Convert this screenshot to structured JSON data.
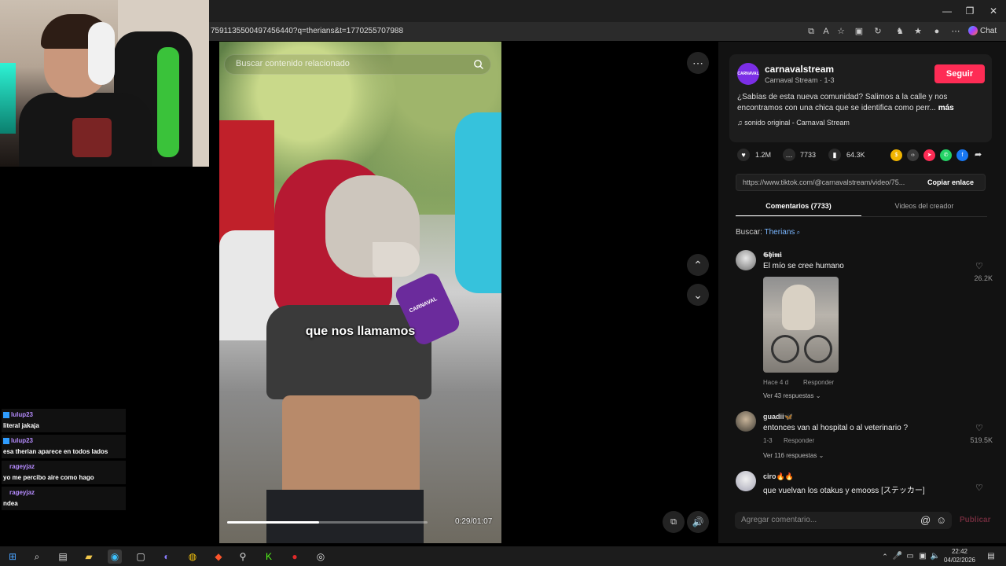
{
  "browser": {
    "url": "7591135500497456440?q=therians&t=1770255707988",
    "chat_label": "Chat",
    "window_controls": {
      "minimize": "—",
      "maximize": "❐",
      "close": "✕"
    }
  },
  "stream_chat": {
    "messages": [
      {
        "user": "lulup23",
        "text": "literal jakaja"
      },
      {
        "user": "lulup23",
        "text": "esa therian aparece en todos lados"
      },
      {
        "user": "rageyjaz",
        "text": "yo me percibo aire como hago"
      },
      {
        "user": "rageyjaz",
        "text": "ndea"
      }
    ]
  },
  "video": {
    "search_placeholder": "Buscar contenido relacionado",
    "caption": "que nos llamamos",
    "time": "0:29/01:07",
    "progress": 0.46,
    "mic_label": "CARNAVAL"
  },
  "post": {
    "avatar_text": "CARNAVAL",
    "creator_name": "carnavalstream",
    "creator_sub": "Carnaval Stream · 1-3",
    "follow_label": "Seguir",
    "description": "¿Sabías de esta nueva comunidad? Salimos a la calle y nos encontramos con una chica que se identifica como perr...",
    "more_label": "más",
    "sound": "sonido original - Carnaval Stream",
    "likes": "1.2M",
    "comments_count": "7733",
    "saves": "64.3K",
    "link": "https://www.tiktok.com/@carnavalstream/video/75...",
    "copy_link_label": "Copiar enlace",
    "share_colors": {
      "coin": "#f0b400",
      "embed": "#3a3a3a",
      "send": "#fe2c55",
      "whatsapp": "#25d366",
      "facebook": "#1877f2"
    }
  },
  "tabs": {
    "comments": "Comentarios (7733)",
    "creator_videos": "Videos del creador"
  },
  "search": {
    "label": "Buscar:",
    "term": "Therians"
  },
  "comments": [
    {
      "name": "𝕲𝖍𝖎𝖒𝖎",
      "text": "El mío se cree humano",
      "likes": "26.2K",
      "date": "Hace 4 d",
      "reply": "Responder",
      "replies": "Ver 43 respuestas"
    },
    {
      "name": "guadii🦋",
      "text": "entonces van al hospital o al veterinario ?",
      "likes": "519.5K",
      "date": "1-3",
      "reply": "Responder",
      "replies": "Ver 116 respuestas"
    },
    {
      "name": "ciro🔥🔥",
      "text": "que vuelvan los otakus y emooss [ステッカー]",
      "likes": ""
    }
  ],
  "comment_box": {
    "placeholder": "Agregar comentario...",
    "publish_label": "Publicar"
  },
  "taskbar": {
    "time": "22:42",
    "date": "04/02/2026"
  }
}
